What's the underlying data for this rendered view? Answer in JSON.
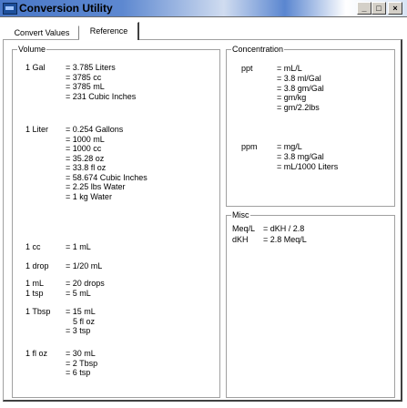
{
  "window": {
    "title": "Conversion Utility",
    "controls": [
      "_",
      "□",
      "×"
    ]
  },
  "tabs": [
    {
      "label": "Convert Values",
      "active": false
    },
    {
      "label": "Reference",
      "active": true
    }
  ],
  "volume": {
    "title": "Volume",
    "rows": [
      {
        "label": "1 Gal",
        "lines": [
          "= 3.785 Liters",
          "= 3785 cc",
          "= 3785 mL",
          "= 231 Cubic Inches"
        ]
      },
      {
        "label": "1 Liter",
        "lines": [
          "= 0.254 Gallons",
          "= 1000 mL",
          "= 1000 cc",
          "= 35.28 oz",
          "= 33.8 fl oz",
          "= 58.674 Cubic Inches",
          "= 2.25 lbs Water",
          "= 1 kg Water"
        ]
      },
      {
        "label": "1 cc",
        "lines": [
          "= 1 mL"
        ]
      },
      {
        "label": "1 drop",
        "lines": [
          "= 1/20 mL"
        ]
      },
      {
        "label": "1 mL",
        "lines": [
          "= 20 drops"
        ]
      },
      {
        "label": "1 tsp",
        "lines": [
          "= 5 mL"
        ]
      },
      {
        "label": "1 Tbsp",
        "lines": [
          "= 15 mL",
          "5 fl oz",
          "= 3 tsp"
        ]
      },
      {
        "label": "1 fl oz",
        "lines": [
          "= 30 mL",
          "= 2 Tbsp",
          "= 6 tsp"
        ]
      }
    ]
  },
  "concentration": {
    "title": "Concentration",
    "rows": [
      {
        "label": "ppt",
        "lines": [
          "= mL/L",
          "= 3.8 ml/Gal",
          "= 3.8 gm/Gal",
          "= gm/kg",
          "= gm/2.2lbs"
        ]
      },
      {
        "label": "ppm",
        "lines": [
          "= mg/L",
          "= 3.8 mg/Gal",
          "= mL/1000 Liters"
        ]
      }
    ]
  },
  "misc": {
    "title": "Misc",
    "rows": [
      {
        "label": "Meq/L",
        "lines": [
          "= dKH / 2.8"
        ]
      },
      {
        "label": "dKH",
        "lines": [
          "= 2.8 Meq/L"
        ]
      }
    ]
  }
}
